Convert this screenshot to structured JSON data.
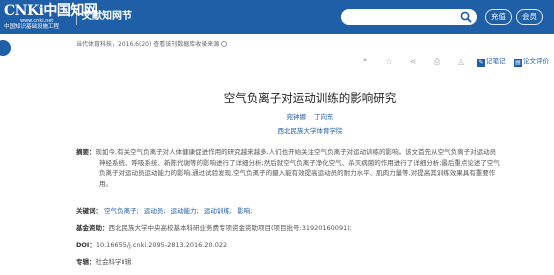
{
  "header": {
    "logo_main": "CNKi中国知网",
    "logo_url": "www.cnki.net",
    "logo_sub": "中国知识基础设施工程",
    "site_name": "文献知网节",
    "charge_label": "充值",
    "member_label": "会员"
  },
  "meta": {
    "line": "当代体育科技，2016,6(20)  查看该刊数据库收录来源"
  },
  "toolbar": {
    "notes_label": "记笔记",
    "evaluate_label": "论文评价"
  },
  "article": {
    "title": "空气负离子对运动训练的影响研究",
    "authors": [
      "宛钟娜",
      "丁向东"
    ],
    "affiliation": "西北民族大学体育学院",
    "abstract_label": "摘要：",
    "abstract_lines": [
      "现如今,有关空气负离子对人体健康促进作用的研究越来越多,人们也开始关注空气负离子对运动训练的影响。该文首先从空气负离子对运动员",
      "神经系统、呼吸系统、新陈代谢等的影响进行了详细分析;然后就空气负离子净化空气、杀灭病菌的作用进行了详细分析;最后重点论述了空气",
      "负离子对运动员运动能力的影响,通过试验发现,空气负离子的摄入能有效提高运动员的耐力水平、肌肉力量等,对提高其训练效果具有重要作",
      "用。"
    ],
    "keywords_label": "关键词：",
    "keywords": [
      "空气负离子;",
      "运动员;",
      "运动能力;",
      "运动训练;",
      "影响;"
    ],
    "fund_label": "基金资助：",
    "fund_text": "西北民族大学中央高校基本科研业务费专项资金资助项目(项目批号:31920160091);",
    "doi_label": "DOI：",
    "doi_text": "10.16655/j.cnki.2095-2813.2016.20.022",
    "album_label": "专辑：",
    "album_text": "社会科学Ⅱ辑"
  },
  "colors": {
    "brand": "#1f5fa8",
    "link": "#1f5fa8"
  },
  "icons": [
    "search-icon",
    "quote-icon",
    "star-icon",
    "share-icon",
    "print-icon",
    "bell-icon",
    "note-icon",
    "evaluate-icon"
  ]
}
